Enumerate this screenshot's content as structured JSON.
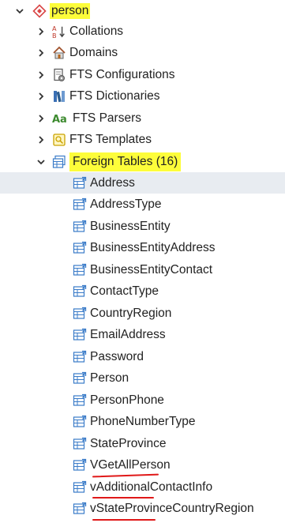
{
  "tree": {
    "root": {
      "label": "person",
      "icon": "schema-diamond-icon",
      "expanded": true,
      "highlight_color": "#fdfd3a"
    },
    "children": [
      {
        "label": "Collations",
        "icon": "collation-icon",
        "expanded": false
      },
      {
        "label": "Domains",
        "icon": "domain-house-icon",
        "expanded": false
      },
      {
        "label": "FTS Configurations",
        "icon": "fts-configuration-icon",
        "expanded": false
      },
      {
        "label": "FTS Dictionaries",
        "icon": "fts-dictionary-icon",
        "expanded": false
      },
      {
        "label": "FTS Parsers",
        "icon": "fts-parser-icon",
        "expanded": false
      },
      {
        "label": "FTS Templates",
        "icon": "fts-template-icon",
        "expanded": false
      },
      {
        "label": "Foreign Tables (16)",
        "icon": "foreign-table-group-icon",
        "expanded": true,
        "highlighted": true
      }
    ],
    "foreign_tables": [
      "Address",
      "AddressType",
      "BusinessEntity",
      "BusinessEntityAddress",
      "BusinessEntityContact",
      "ContactType",
      "CountryRegion",
      "EmailAddress",
      "Password",
      "Person",
      "PersonPhone",
      "PhoneNumberType",
      "StateProvince",
      "VGetAllPerson",
      "vAdditionalContactInfo",
      "vStateProvinceCountryRegion"
    ],
    "selected_item": "Address",
    "annotation_color": "#e01919",
    "selection_color": "#e8ecf1"
  }
}
